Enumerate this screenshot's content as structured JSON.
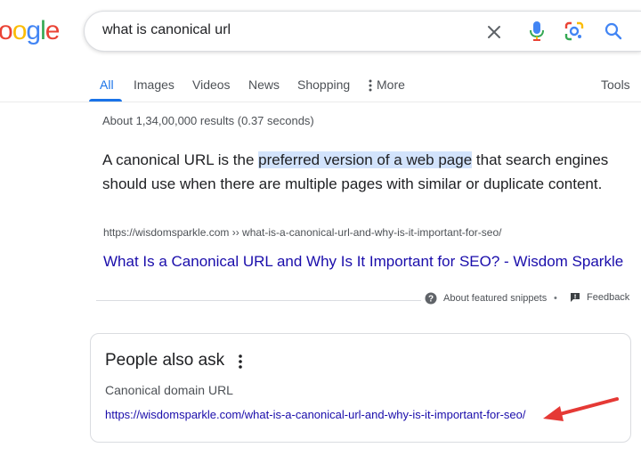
{
  "logo": {
    "parts": [
      "o",
      "o",
      "g",
      "l",
      "e"
    ]
  },
  "search": {
    "query": "what is canonical url"
  },
  "icons": {
    "clear": "close-icon",
    "voice": "microphone-icon",
    "lens": "lens-camera-icon",
    "search": "search-icon",
    "help": "question-circle-icon",
    "feedback": "feedback-flag-icon",
    "menu": "three-dots-vertical-icon"
  },
  "tabs": [
    {
      "label": "All"
    },
    {
      "label": "Images"
    },
    {
      "label": "Videos"
    },
    {
      "label": "News"
    },
    {
      "label": "Shopping"
    },
    {
      "label": "More"
    }
  ],
  "tools_label": "Tools",
  "result_stats": "About 1,34,00,000 results (0.37 seconds)",
  "featured_snippet": {
    "text_before": "A canonical URL is the ",
    "highlight": "preferred version of a web page",
    "text_after": " that search engines should use when there are multiple pages with similar or duplicate content.",
    "cite": "https://wisdomsparkle.com ›› what-is-a-canonical-url-and-why-is-it-important-for-seo/",
    "link_title": "What Is a Canonical URL and Why Is It Important for SEO? - Wisdom Sparkle",
    "about_label": "About featured snippets",
    "separator": "•",
    "feedback_label": "Feedback"
  },
  "people_also_ask": {
    "title": "People also ask",
    "question": "Canonical domain URL",
    "link": "https://wisdomsparkle.com/what-is-a-canonical-url-and-why-is-it-important-for-seo/"
  },
  "colors": {
    "accent": "#1a73e8",
    "link": "#1a0dab",
    "highlight": "#d2e3fc",
    "annotation_arrow": "#e53935"
  }
}
